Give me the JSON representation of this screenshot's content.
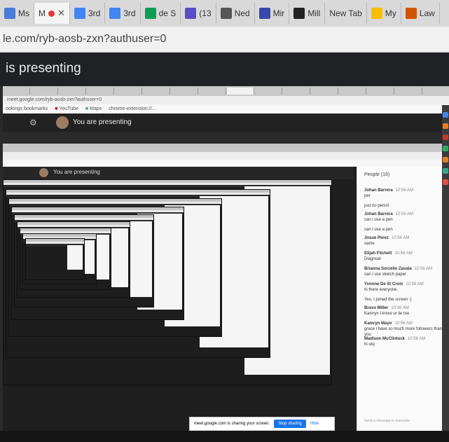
{
  "tabs": [
    {
      "label": "Ms",
      "icon": "document-icon",
      "color": "#4a7bd6"
    },
    {
      "label": "M",
      "icon": "recording-icon",
      "color": "#ffffff",
      "active": true
    },
    {
      "label": "3rd",
      "icon": "docs-icon",
      "color": "#4285f4"
    },
    {
      "label": "3rd",
      "icon": "docs-icon",
      "color": "#4285f4"
    },
    {
      "label": "de S",
      "icon": "sheets-icon",
      "color": "#0f9d58"
    },
    {
      "label": "(13",
      "icon": "mail-icon",
      "color": "#5c4bc7"
    },
    {
      "label": "Ned",
      "icon": "chrome-icon",
      "color": "#555555"
    },
    {
      "label": "Mir",
      "icon": "calendar-icon",
      "color": "#3949ab"
    },
    {
      "label": "Mill",
      "icon": "wp-icon",
      "color": "#222222"
    },
    {
      "label": "New Tab",
      "icon": "",
      "color": ""
    },
    {
      "label": "My",
      "icon": "drive-icon",
      "color": "#fbbc04"
    },
    {
      "label": "Law",
      "icon": "law-icon",
      "color": "#d35400"
    }
  ],
  "address": "le.com/ryb-aosb-zxn?authuser=0",
  "presenting_title": "is presenting",
  "inner": {
    "address": "meet.google.com/ryb-aosb-zxn?authuser=0",
    "bookmarks": [
      "ookings bookmarks",
      "YouTube",
      "Maps",
      "chrome-extension://..."
    ],
    "presenting": "You are presenting",
    "tab_label": "Meet"
  },
  "chat": {
    "header": "People (18)",
    "messages": [
      {
        "who": "Johan Barrera",
        "time": "10:56 AM",
        "text": "per"
      },
      {
        "who": "",
        "time": "",
        "text": "just no pencil"
      },
      {
        "who": "Johan Barrera",
        "time": "10:56 AM",
        "text": "can i use a pen"
      },
      {
        "who": "",
        "time": "",
        "text": "can i use a pen"
      },
      {
        "who": "Josue Perez",
        "time": "10:56 AM",
        "text": "same"
      },
      {
        "who": "Elijah Fitchett",
        "time": "10:56 AM",
        "text": "Diagnoal"
      },
      {
        "who": "Brianna Sorzello Zavala",
        "time": "10:56 AM",
        "text": "can i use sketch paper"
      },
      {
        "who": "Yvonne De St Croix",
        "time": "10:56 AM",
        "text": "hi there everyone."
      },
      {
        "who": "",
        "time": "",
        "text": "Yes, I joined the screen :)"
      },
      {
        "who": "Bravo Miller",
        "time": "10:56 AM",
        "text": "Kamryn I know ur lie too"
      },
      {
        "who": "Kamryn Mayo",
        "time": "10:56 AM",
        "text": "grace i have so much more followers than you"
      },
      {
        "who": "Madison McClintock",
        "time": "10:56 AM",
        "text": "hi sky"
      }
    ],
    "input_placeholder": "Send a message to everyone"
  },
  "share_bar": {
    "text": "meet.google.com is sharing your screen.",
    "stop": "Stop sharing",
    "hide": "Hide"
  },
  "colors": {
    "meet_dark": "#202124",
    "stop_blue": "#1a73e8",
    "record_red": "#e53935"
  }
}
